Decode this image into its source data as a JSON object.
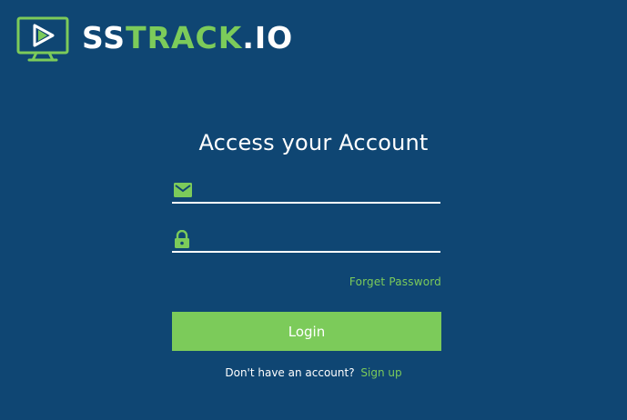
{
  "brand": {
    "part1": "SS",
    "part2": "TRACK",
    "part3": ".IO",
    "accent_color": "#7ccb5a",
    "background_color": "#0f4673"
  },
  "login": {
    "title": "Access your Account",
    "email_icon": "mail-icon",
    "email_value": "",
    "password_icon": "lock-icon",
    "password_value": "",
    "forgot_label": "Forget Password",
    "login_label": "Login",
    "signup_prompt": "Don't have an account?",
    "signup_label": "Sign up"
  }
}
